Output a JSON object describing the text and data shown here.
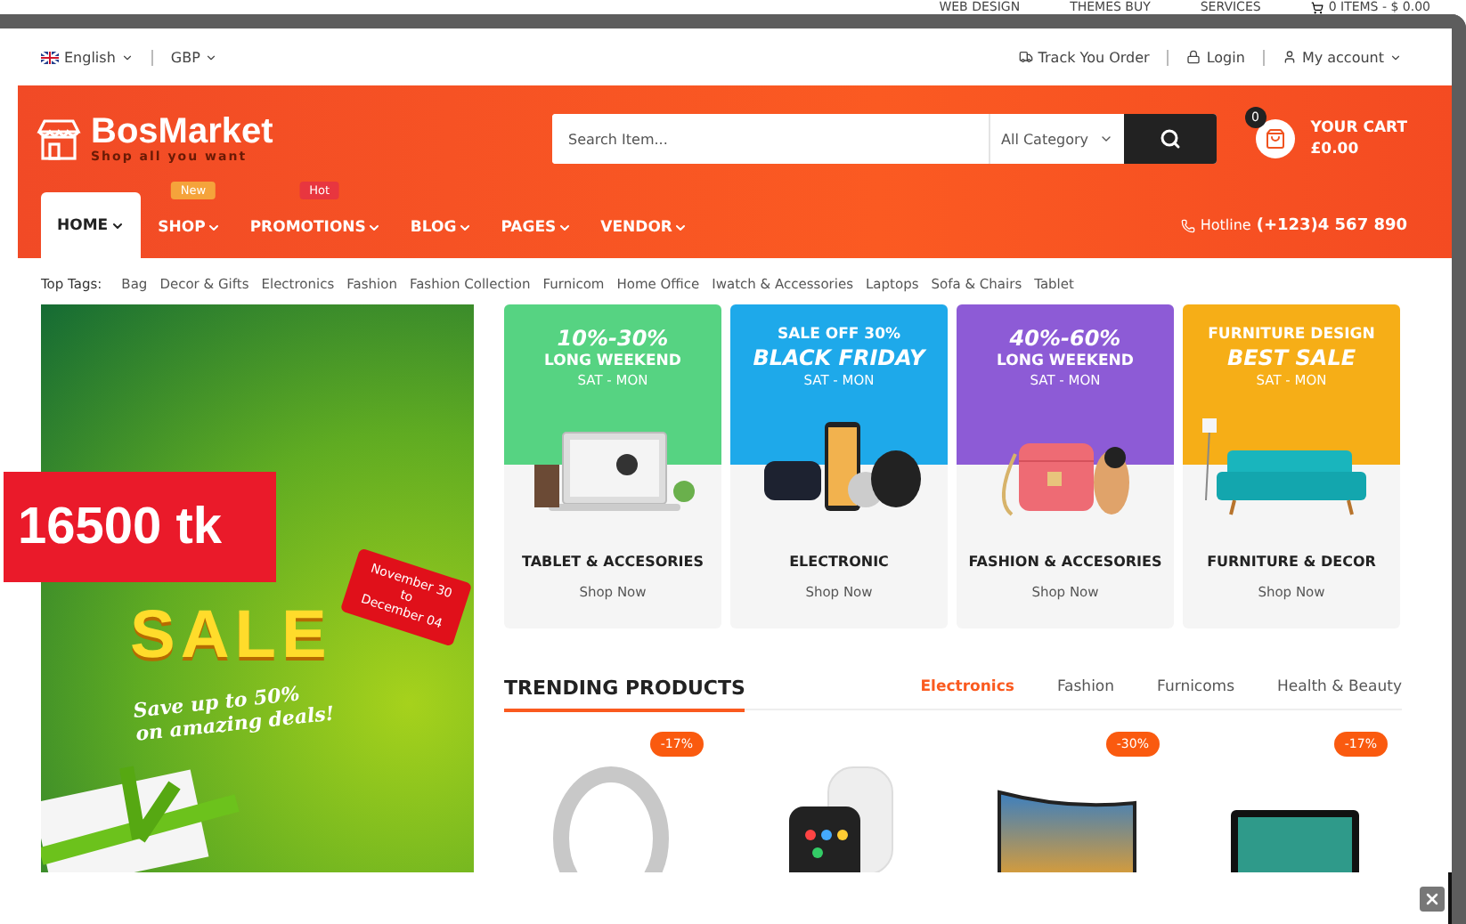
{
  "top_strip": {
    "links": [
      "WEB DESIGN",
      "THEMES BUY",
      "SERVICES"
    ],
    "cart": "0 ITEMS - $ 0.00"
  },
  "topbar": {
    "language": "English",
    "currency": "GBP",
    "links": [
      {
        "kind": "track",
        "label": "Track You Order"
      },
      {
        "kind": "login",
        "label": "Login"
      },
      {
        "kind": "account",
        "label": "My account"
      }
    ]
  },
  "header": {
    "logo": {
      "name": "BosMarket",
      "tagline": "Shop all you want"
    },
    "search": {
      "placeholder": "Search Item...",
      "category": "All Category"
    },
    "cart": {
      "count": "0",
      "title": "YOUR CART",
      "total": "£0.00"
    }
  },
  "nav": {
    "items": [
      {
        "label": "HOME",
        "selected": true
      },
      {
        "label": "SHOP",
        "selected": false,
        "badge": {
          "text": "New",
          "color": "#f5a33b"
        }
      },
      {
        "label": "PROMOTIONS",
        "selected": false,
        "badge": {
          "text": "Hot",
          "color": "#e8363f"
        }
      },
      {
        "label": "BLOG",
        "selected": false
      },
      {
        "label": "PAGES",
        "selected": false
      },
      {
        "label": "VENDOR",
        "selected": false
      }
    ],
    "hotline": {
      "label": "Hotline",
      "number": "(+123)4 567 890"
    }
  },
  "top_tags": {
    "label": "Top Tags:",
    "tags": [
      "Bag",
      "Decor & Gifts",
      "Electronics",
      "Fashion",
      "Fashion Collection",
      "Furnicom",
      "Home Office",
      "Iwatch & Accessories",
      "Laptops",
      "Sofa & Chairs",
      "Tablet"
    ]
  },
  "promo_banner": {
    "headline": "SALE",
    "tagline": [
      "Save up to 50%",
      "on amazing deals!"
    ],
    "date_tag": [
      "November 30",
      "to",
      "December 04"
    ]
  },
  "category_cards": [
    {
      "kind": "laptop",
      "color": "#56d382",
      "lines": [
        {
          "kind": "big",
          "text": "10%-30%"
        },
        {
          "kind": "mid",
          "text": "LONG WEEKEND"
        },
        {
          "kind": "small",
          "text": "SAT - MON"
        }
      ],
      "title": "TABLET & ACCESORIES",
      "link": "Shop Now"
    },
    {
      "kind": "devices",
      "color": "#1ea9ea",
      "lines": [
        {
          "kind": "mid",
          "text": "SALE OFF 30%"
        },
        {
          "kind": "big",
          "text": "BLACK FRIDAY"
        },
        {
          "kind": "small",
          "text": "SAT - MON"
        }
      ],
      "title": "ELECTRONIC",
      "link": "Shop Now"
    },
    {
      "kind": "handbag",
      "color": "#8d5bd6",
      "lines": [
        {
          "kind": "big",
          "text": "40%-60%"
        },
        {
          "kind": "mid",
          "text": "LONG WEEKEND"
        },
        {
          "kind": "small",
          "text": "SAT - MON"
        }
      ],
      "title": "FASHION & ACCESORIES",
      "link": "Shop Now"
    },
    {
      "kind": "sofa",
      "color": "#f6ae17",
      "lines": [
        {
          "kind": "mid",
          "text": "FURNITURE DESIGN"
        },
        {
          "kind": "big",
          "text": "BEST SALE"
        },
        {
          "kind": "small",
          "text": "SAT - MON"
        }
      ],
      "title": "FURNITURE & DECOR",
      "link": "Shop Now"
    }
  ],
  "trending": {
    "title": "TRENDING PRODUCTS",
    "tabs": [
      {
        "label": "Electronics",
        "selected": true
      },
      {
        "label": "Fashion",
        "selected": false
      },
      {
        "label": "Furnicoms",
        "selected": false
      },
      {
        "label": "Health & Beauty",
        "selected": false
      }
    ],
    "products": [
      {
        "kind": "band",
        "badge": "-17%"
      },
      {
        "kind": "watch"
      },
      {
        "kind": "tv",
        "badge": "-30%"
      },
      {
        "kind": "laptop",
        "badge": "-17%"
      }
    ]
  },
  "price_label": "16500 tk"
}
